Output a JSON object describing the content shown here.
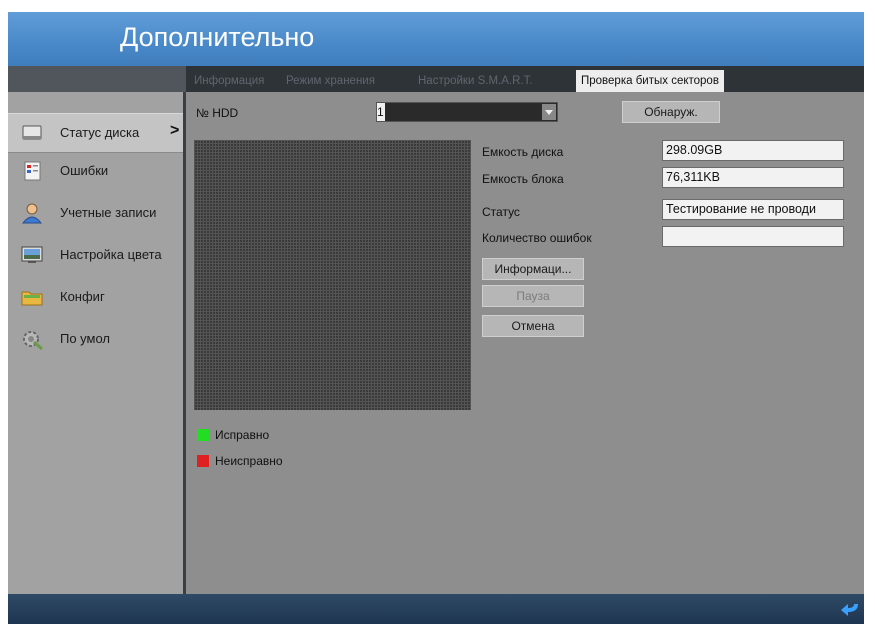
{
  "header": {
    "title": "Дополнительно"
  },
  "tabs": [
    {
      "label": "Информация"
    },
    {
      "label": "Режим хранения"
    },
    {
      "label": "Настройки S.M.A.R.T."
    },
    {
      "label": "Проверка битых секторов"
    }
  ],
  "sidebar": {
    "items": [
      {
        "label": "Статус диска",
        "icon": "hard-disk-icon"
      },
      {
        "label": "Ошибки",
        "icon": "error-log-icon"
      },
      {
        "label": "Учетные записи",
        "icon": "user-icon"
      },
      {
        "label": "Настройка цвета",
        "icon": "display-icon"
      },
      {
        "label": "Конфиг",
        "icon": "folder-icon"
      },
      {
        "label": "По умол",
        "icon": "settings-gear-icon"
      }
    ],
    "arrow": ">"
  },
  "hdd": {
    "label": "№ HDD",
    "selected": "1",
    "detect_button": "Обнаруж."
  },
  "info": {
    "disk_capacity_label": "Емкость диска",
    "disk_capacity_value": "298.09GB",
    "block_capacity_label": "Емкость блока",
    "block_capacity_value": "76,311KB",
    "status_label": "Статус",
    "status_value": "Тестирование не проводи",
    "errors_label": "Количество ошибок",
    "errors_value": ""
  },
  "buttons": {
    "info": "Информаци...",
    "pause": "Пауза",
    "cancel": "Отмена"
  },
  "legend": [
    {
      "label": "Исправно",
      "color": "#22dd22"
    },
    {
      "label": "Неисправно",
      "color": "#e02020"
    }
  ],
  "colors": {
    "title_bar": "#4a89c9",
    "active_tab": "#ededed"
  }
}
